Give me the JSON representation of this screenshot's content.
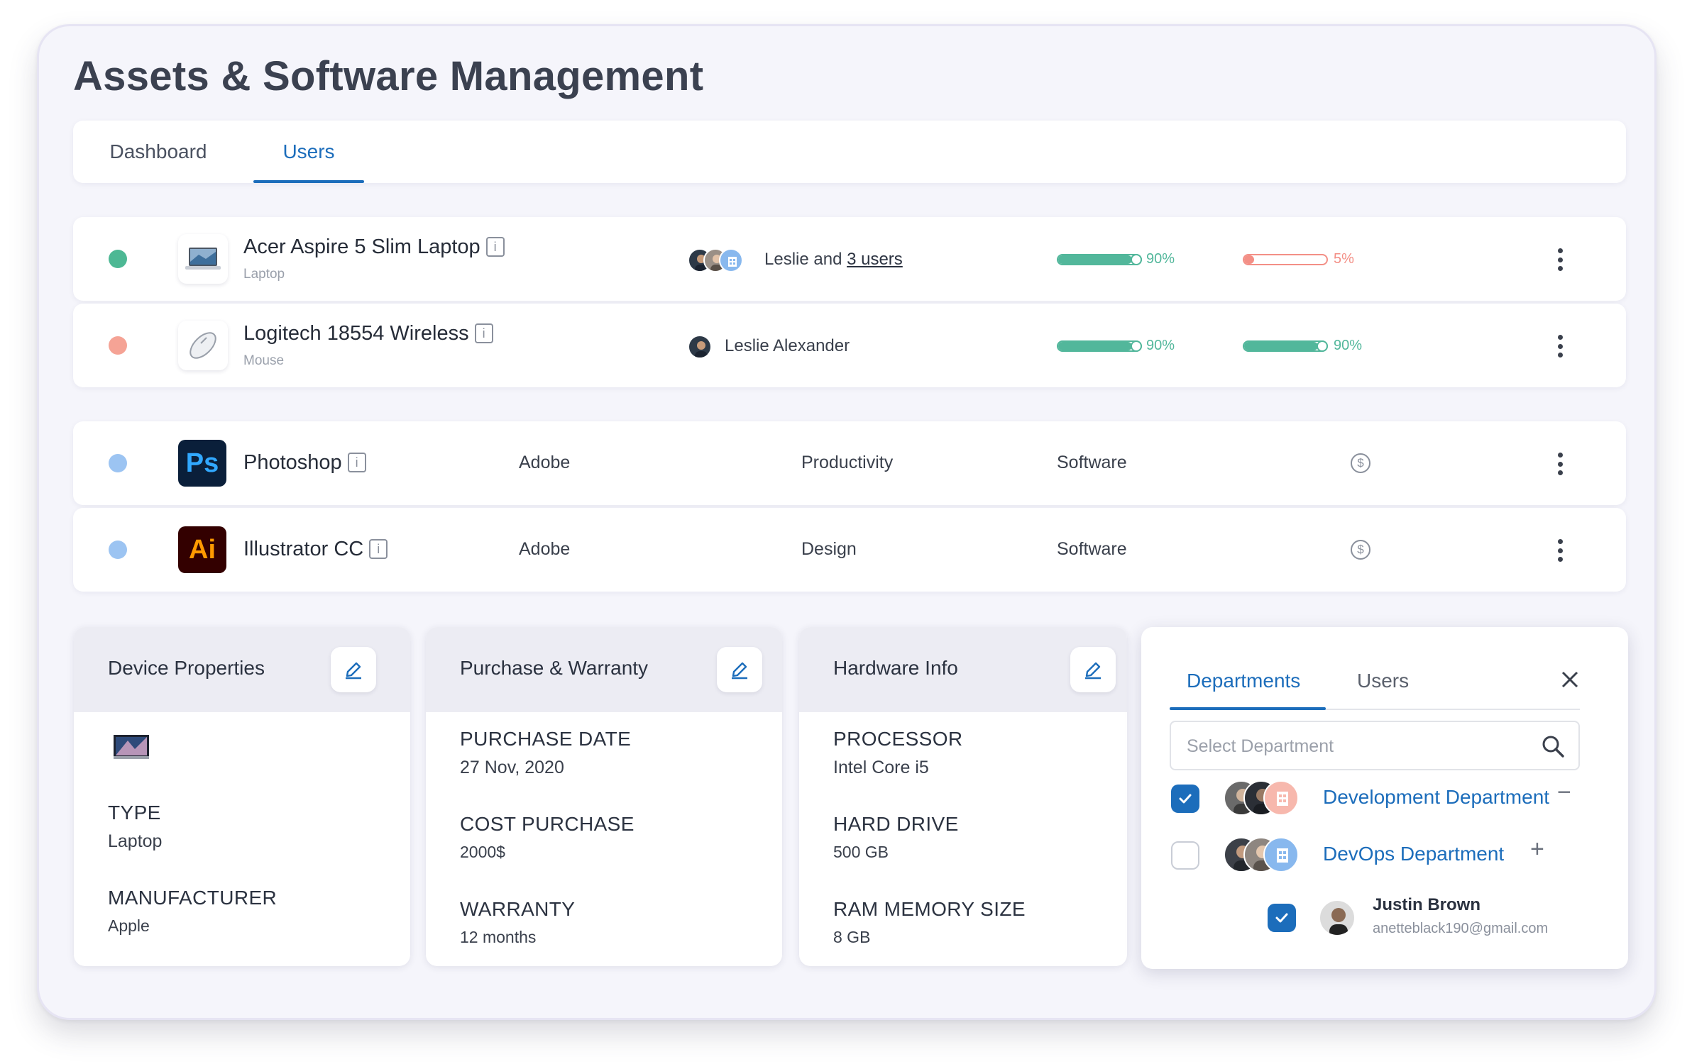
{
  "title": "Assets & Software Management",
  "tabs": [
    {
      "label": "Dashboard",
      "active": false
    },
    {
      "label": "Users",
      "active": true
    }
  ],
  "hardware_rows": [
    {
      "name": "Acer Aspire 5 Slim Laptop",
      "type": "Laptop",
      "status_color": "#4db894",
      "users_lead": "Leslie and ",
      "users_link": "3 users",
      "progress1": {
        "value": 0.9,
        "label": "90%",
        "color": "#52b79b"
      },
      "progress2": {
        "value": 0.05,
        "label": "5%",
        "color": "#f38f86"
      }
    },
    {
      "name": "Logitech 18554 Wireless",
      "type": "Mouse",
      "status_color": "#f5a395",
      "users_lead": "Leslie Alexander",
      "users_link": "",
      "progress1": {
        "value": 0.9,
        "label": "90%",
        "color": "#52b79b"
      },
      "progress2": {
        "value": 0.9,
        "label": "90%",
        "color": "#52b79b"
      }
    }
  ],
  "software_rows": [
    {
      "name": "Photoshop",
      "logo": "Ps",
      "vendor": "Adobe",
      "category": "Productivity",
      "kind": "Software",
      "status_color": "#9cc4f2"
    },
    {
      "name": "Illustrator CC",
      "logo": "Ai",
      "vendor": "Adobe",
      "category": "Design",
      "kind": "Software",
      "status_color": "#9cc4f2"
    }
  ],
  "device_properties": {
    "title": "Device Properties",
    "type_label": "TYPE",
    "type_value": "Laptop",
    "manufacturer_label": "MANUFACTURER",
    "manufacturer_value": "Apple"
  },
  "purchase_warranty": {
    "title": "Purchase & Warranty",
    "date_label": "PURCHASE DATE",
    "date_value": "27 Nov, 2020",
    "cost_label": "COST PURCHASE",
    "cost_value": "2000$",
    "warranty_label": "WARRANTY",
    "warranty_value": "12 months"
  },
  "hardware_info": {
    "title": "Hardware Info",
    "processor_label": "PROCESSOR",
    "processor_value": "Intel Core i5",
    "drive_label": "HARD DRIVE",
    "drive_value": "500 GB",
    "ram_label": "RAM MEMORY SIZE",
    "ram_value": "8 GB"
  },
  "departments_panel": {
    "tab_active": "Departments",
    "tab_other": "Users",
    "search_placeholder": "Select Department",
    "departments": [
      {
        "name": "Development Department",
        "checked": true,
        "action": "−"
      },
      {
        "name": "DevOps Department",
        "checked": false,
        "action": "+"
      }
    ],
    "user": {
      "name": "Justin Brown",
      "email": "anetteblack190@gmail.com",
      "checked": true
    }
  },
  "colors": {
    "accent": "#1c6dbb",
    "progress_green": "#52b79b",
    "progress_red": "#f38f86"
  }
}
